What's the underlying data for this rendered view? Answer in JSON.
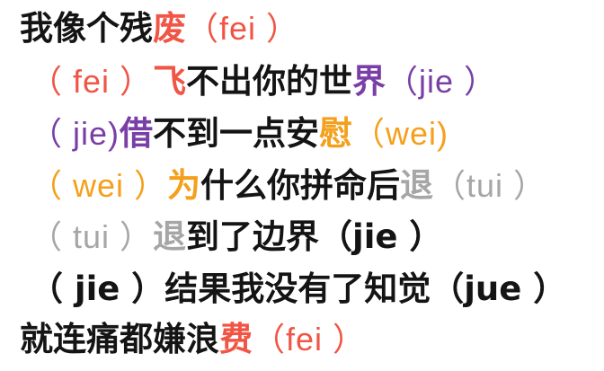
{
  "colors": {
    "dark": "#141414",
    "red": "#f05545",
    "purple": "#7a3fa6",
    "orange": "#f4a01c",
    "gray": "#a6a6a6"
  },
  "lines": [
    {
      "segments": [
        {
          "text": "我像个残",
          "color": "dark"
        },
        {
          "text": "废",
          "color": "red"
        },
        {
          "text": "（fei ）",
          "color": "red",
          "pinyin": true
        }
      ]
    },
    {
      "segments": [
        {
          "text": "（ fei ）",
          "color": "red",
          "pinyin": true
        },
        {
          "text": "飞",
          "color": "red"
        },
        {
          "text": "不出你的世",
          "color": "dark"
        },
        {
          "text": "界",
          "color": "purple"
        },
        {
          "text": "（jie ）",
          "color": "purple",
          "pinyin": true
        }
      ]
    },
    {
      "segments": [
        {
          "text": "（ jie)",
          "color": "purple",
          "pinyin": true
        },
        {
          "text": "借",
          "color": "purple"
        },
        {
          "text": "不到一点安",
          "color": "dark"
        },
        {
          "text": "慰",
          "color": "orange"
        },
        {
          "text": "（wei)",
          "color": "orange",
          "pinyin": true
        }
      ]
    },
    {
      "segments": [
        {
          "text": "（ wei ）",
          "color": "orange",
          "pinyin": true
        },
        {
          "text": "为",
          "color": "orange"
        },
        {
          "text": "什么你拼命后",
          "color": "dark"
        },
        {
          "text": "退",
          "color": "gray"
        },
        {
          "text": "（tui ）",
          "color": "gray",
          "pinyin": true
        }
      ]
    },
    {
      "segments": [
        {
          "text": "（ tui ）",
          "color": "gray",
          "pinyin": true
        },
        {
          "text": "退",
          "color": "gray"
        },
        {
          "text": "到了边界（jie ）",
          "color": "dark"
        }
      ]
    },
    {
      "segments": [
        {
          "text": "（ jie ）结果我没有了知觉（jue ）",
          "color": "dark"
        }
      ]
    },
    {
      "segments": [
        {
          "text": "就连痛都嫌浪",
          "color": "dark"
        },
        {
          "text": "费",
          "color": "red"
        },
        {
          "text": "（fei ）",
          "color": "red",
          "pinyin": true
        }
      ]
    }
  ]
}
